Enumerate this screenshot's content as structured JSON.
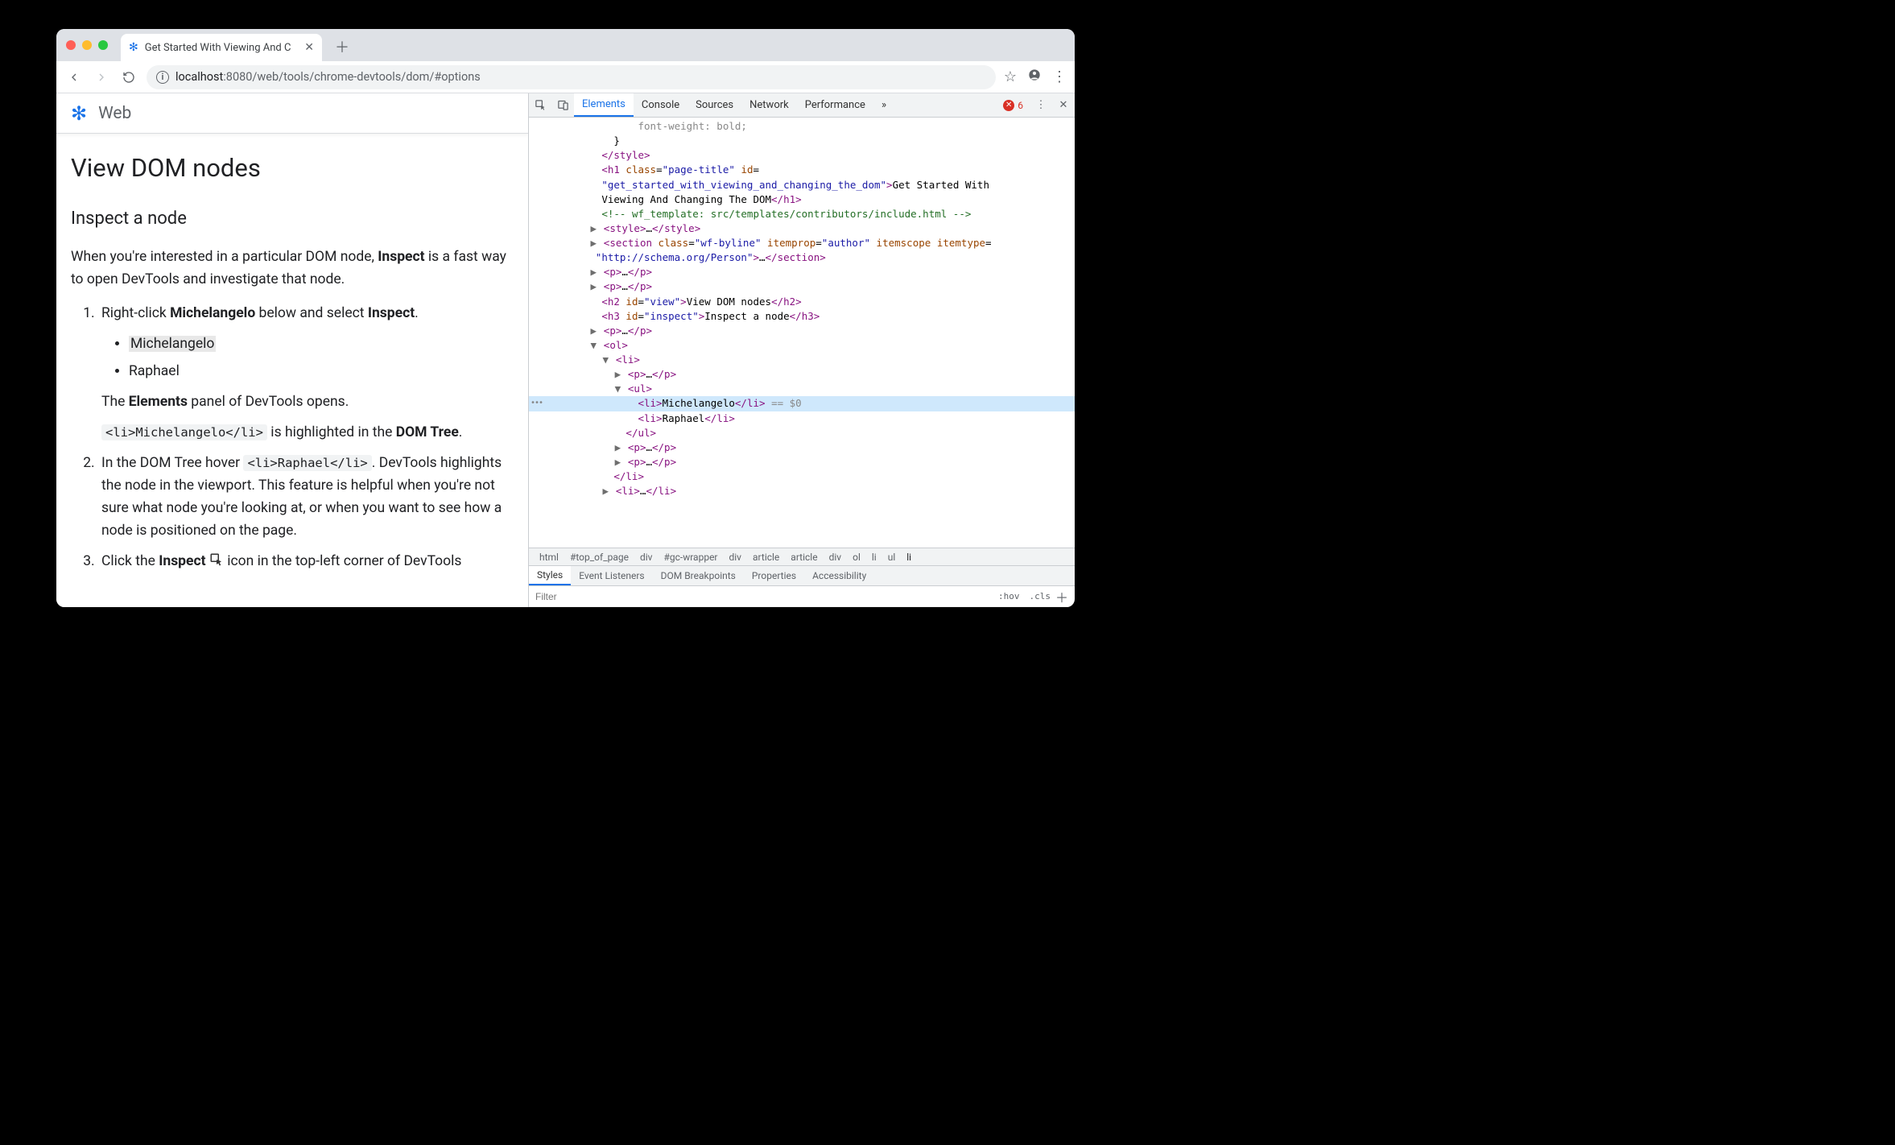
{
  "browser": {
    "tab_title": "Get Started With Viewing And C",
    "url_host": "localhost",
    "url_port": ":8080",
    "url_path": "/web/tools/chrome-devtools/dom/#options"
  },
  "page": {
    "site_name": "Web",
    "h1": "View DOM nodes",
    "h2": "Inspect a node",
    "intro_pre": "When you're interested in a particular DOM node, ",
    "intro_bold": "Inspect",
    "intro_post": " is a fast way to open DevTools and investigate that node.",
    "step1_pre": "Right-click ",
    "step1_bold": "Michelangelo",
    "step1_mid": " below and select ",
    "step1_bold2": "Inspect",
    "step1_post": ".",
    "list_item1": "Michelangelo",
    "list_item2": "Raphael",
    "step1_result_pre": "The ",
    "step1_result_bold": "Elements",
    "step1_result_post": " panel of DevTools opens.",
    "step1_code": "<li>Michelangelo</li>",
    "step1_code_mid": " is highlighted in the ",
    "step1_code_bold": "DOM Tree",
    "step1_code_post": ".",
    "step2_pre": "In the DOM Tree hover ",
    "step2_code": "<li>Raphael</li>",
    "step2_post": ". DevTools highlights the node in the viewport. This feature is helpful when you're not sure what node you're looking at, or when you want to see how a node is positioned on the page.",
    "step3_pre": "Click the ",
    "step3_bold": "Inspect",
    "step3_post": " icon in the top-left corner of DevTools"
  },
  "devtools": {
    "tabs": [
      "Elements",
      "Console",
      "Sources",
      "Network",
      "Performance"
    ],
    "active_tab": "Elements",
    "error_count": "6",
    "dom": {
      "l0": "                  font-weight: bold;",
      "l1": "              }",
      "l2_pre": "            ",
      "l2_tag": "</style>",
      "l3_pre": "            ",
      "l3": "<h1 class=\"page-title\" id=",
      "l4_pre": "            ",
      "l4": "\"get_started_with_viewing_and_changing_the_dom\">Get Started With",
      "l5_pre": "            ",
      "l5": "Viewing And Changing The DOM</h1>",
      "l6_pre": "            ",
      "l6": "<!-- wf_template: src/templates/contributors/include.html -->",
      "l7_pre": "          ▶ ",
      "l7": "<style>…</style>",
      "l8_pre": "          ▶ ",
      "l8": "<section class=\"wf-byline\" itemprop=\"author\" itemscope itemtype=",
      "l9_pre": "           ",
      "l9": "\"http://schema.org/Person\">…</section>",
      "l10_pre": "          ▶ ",
      "l10": "<p>…</p>",
      "l11_pre": "          ▶ ",
      "l11": "<p>…</p>",
      "l12_pre": "            ",
      "l12": "<h2 id=\"view\">View DOM nodes</h2>",
      "l13_pre": "            ",
      "l13": "<h3 id=\"inspect\">Inspect a node</h3>",
      "l14_pre": "          ▶ ",
      "l14": "<p>…</p>",
      "l15_pre": "          ▼ ",
      "l15": "<ol>",
      "l16_pre": "            ▼ ",
      "l16": "<li>",
      "l17_pre": "              ▶ ",
      "l17": "<p>…</p>",
      "l18_pre": "              ▼ ",
      "l18": "<ul>",
      "sel_pre": "                  ",
      "sel": "<li>Michelangelo</li>",
      "sel_post": " == $0",
      "l20_pre": "                  ",
      "l20": "<li>Raphael</li>",
      "l21_pre": "                ",
      "l21": "</ul>",
      "l22_pre": "              ▶ ",
      "l22": "<p>…</p>",
      "l23_pre": "              ▶ ",
      "l23": "<p>…</p>",
      "l24_pre": "              ",
      "l24": "</li>",
      "l25_pre": "            ▶ ",
      "l25": "<li>…</li>"
    },
    "breadcrumbs": [
      "html",
      "#top_of_page",
      "div",
      "#gc-wrapper",
      "div",
      "article",
      "article",
      "div",
      "ol",
      "li",
      "ul",
      "li"
    ],
    "styles_tabs": [
      "Styles",
      "Event Listeners",
      "DOM Breakpoints",
      "Properties",
      "Accessibility"
    ],
    "styles_active": "Styles",
    "filter_placeholder": "Filter",
    "hov": ":hov",
    "cls": ".cls"
  }
}
